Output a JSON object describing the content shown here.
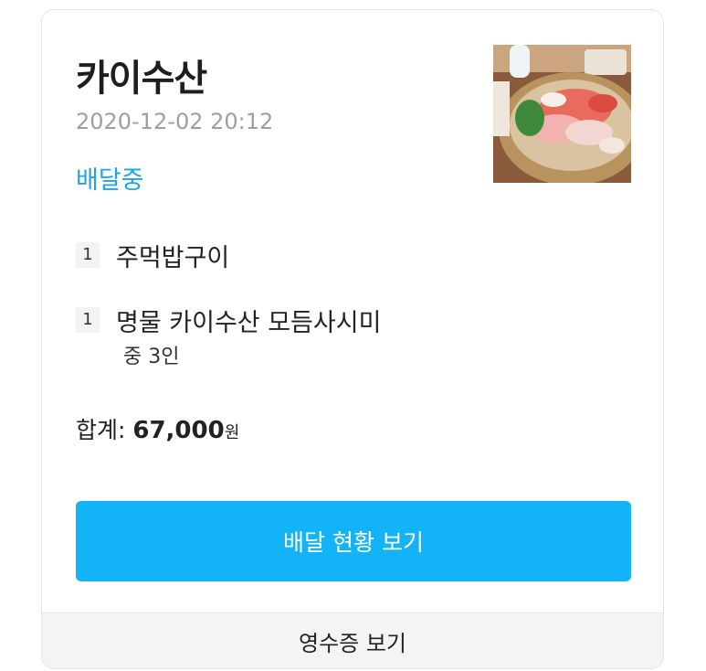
{
  "order": {
    "store_name": "카이수산",
    "date": "2020-12-02 20:12",
    "status": "배달중",
    "thumbnail_icon": "sashimi-platter-photo"
  },
  "items": [
    {
      "qty": "1",
      "name": "주먹밥구이",
      "option": ""
    },
    {
      "qty": "1",
      "name": "명물 카이수산 모듬사시미",
      "option": "중 3인"
    }
  ],
  "total": {
    "label": "합계: ",
    "amount": "67,000",
    "unit": "원"
  },
  "buttons": {
    "track": "배달 현황 보기",
    "receipt": "영수증 보기"
  },
  "colors": {
    "status": "#1ea4e0",
    "primary_button": "#12b3f7",
    "date": "#9aa0a6"
  }
}
